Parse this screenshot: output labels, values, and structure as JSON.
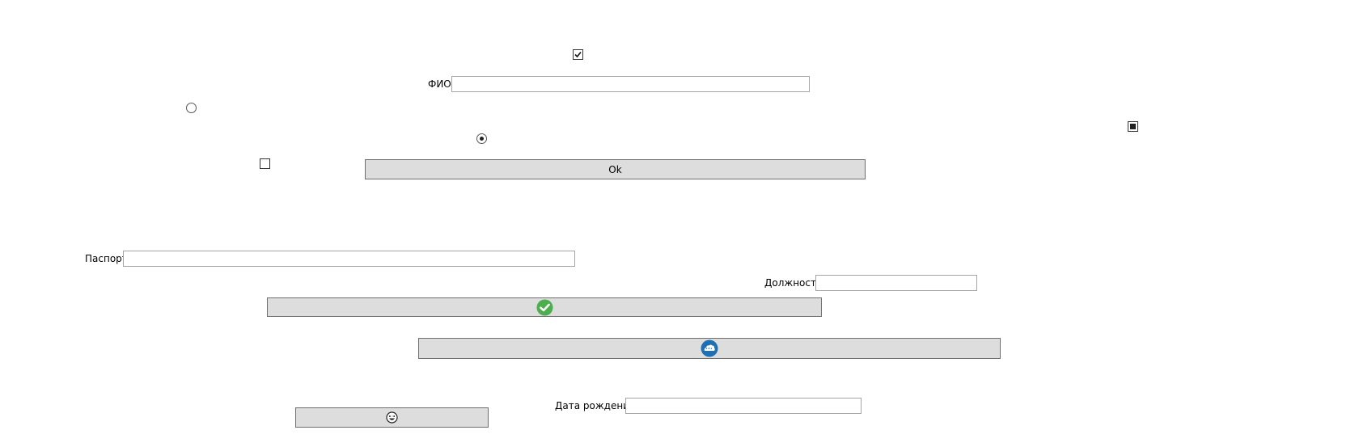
{
  "form": {
    "fio": {
      "label": "ФИО",
      "value": ""
    },
    "passport": {
      "label": "Паспорт",
      "value": ""
    },
    "position": {
      "label": "Должность",
      "value": ""
    },
    "birth_date": {
      "label": "Дата рождения",
      "value": ""
    }
  },
  "buttons": {
    "ok_label": "Ok",
    "check_icon": "green-check-circle-icon",
    "cloud_icon": "blue-cloud-icon",
    "emoji_icon": "laughing-face-icon"
  },
  "controls": {
    "checkbox_checked": true,
    "checkbox_unchecked": false,
    "checkbox_indeterminate": "indeterminate",
    "radio_unselected": false,
    "radio_selected": true
  },
  "colors": {
    "button_bg": "#dddddd",
    "check_green": "#4cae4c",
    "cloud_blue": "#1f6fb5"
  }
}
